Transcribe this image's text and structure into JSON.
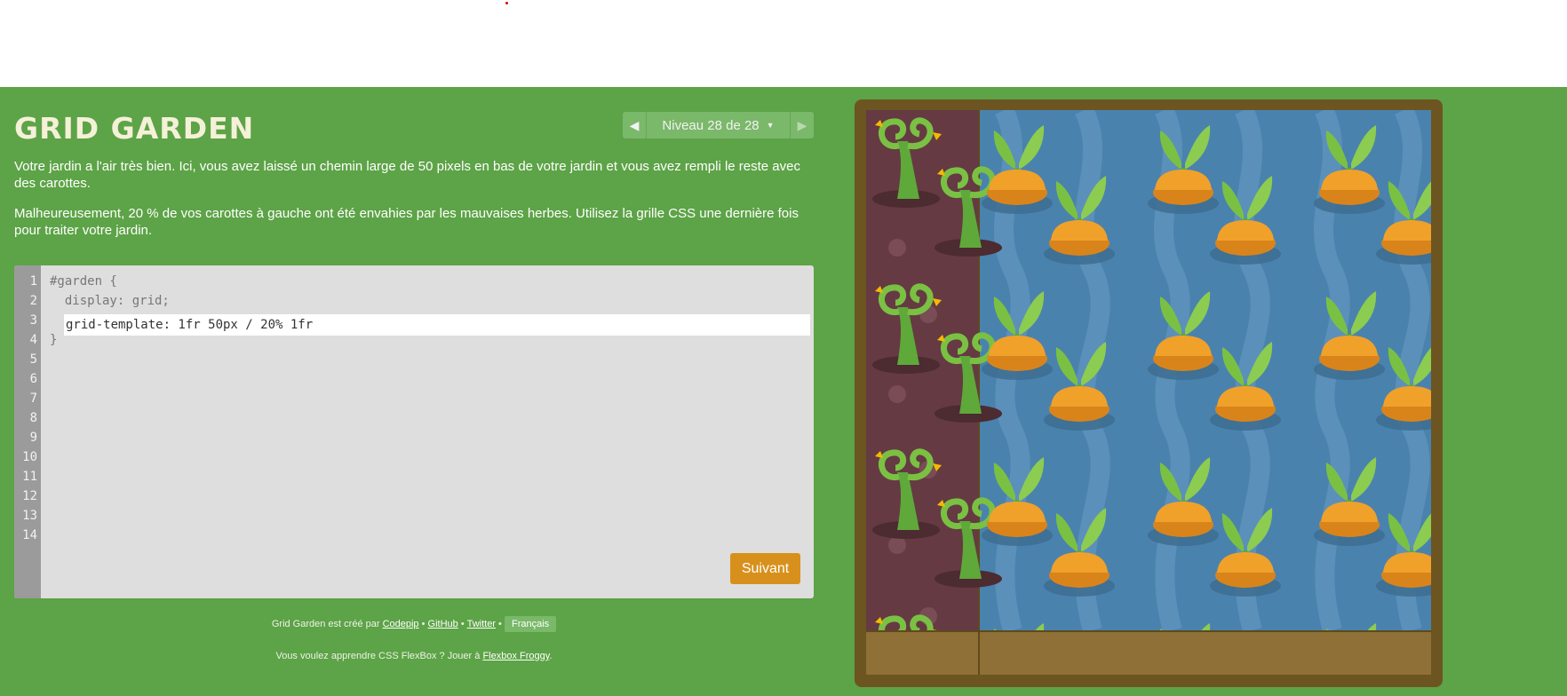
{
  "app": {
    "title": "GRID GARDEN",
    "level_selector": {
      "prev_icon": "arrow-left-icon",
      "next_icon": "arrow-right-icon",
      "indicator": "Niveau 28 de 28",
      "caret_icon": "caret-down-icon"
    }
  },
  "instructions": {
    "p1": "Votre jardin a l'air très bien. Ici, vous avez laissé un chemin large de 50 pixels en bas de votre jardin et vous avez rempli le reste avec des carottes.",
    "p2": "Malheureusement, 20 % de vos carottes à gauche ont été envahies par les mauvaises herbes. Utilisez la grille CSS une dernière fois pour traiter votre jardin."
  },
  "editor": {
    "line_numbers": [
      "1",
      "2",
      "3",
      "4",
      "5",
      "6",
      "7",
      "8",
      "9",
      "10",
      "11",
      "12",
      "13",
      "14"
    ],
    "line1": "#garden {",
    "line2": "  display: grid;",
    "input_value": "grid-template: 1fr 50px / 20% 1fr",
    "line4": "}",
    "submit_label": "Suivant"
  },
  "footer": {
    "credit_prefix": "Grid Garden est créé par",
    "codepip": "Codepip",
    "sep": "•",
    "github": "GitHub",
    "twitter": "Twitter",
    "language": "Français",
    "froggy_prefix": "Vous voulez apprendre CSS FlexBox ? Jouer à",
    "froggy_link": "Flexbox Froggy",
    "froggy_suffix": "."
  },
  "colors": {
    "background": "#5da347",
    "title": "#f4f1d8",
    "editor_bg": "#dedede",
    "submit": "#d8901c",
    "garden_frame": "#6c5520",
    "weed_soil": "#653a43",
    "carrot_water": "#4a82ae",
    "carrot_orange": "#f0a12a",
    "leaf": "#7ac143"
  },
  "garden": {
    "weed_icon": "weed-icon",
    "carrot_icon": "carrot-icon"
  }
}
